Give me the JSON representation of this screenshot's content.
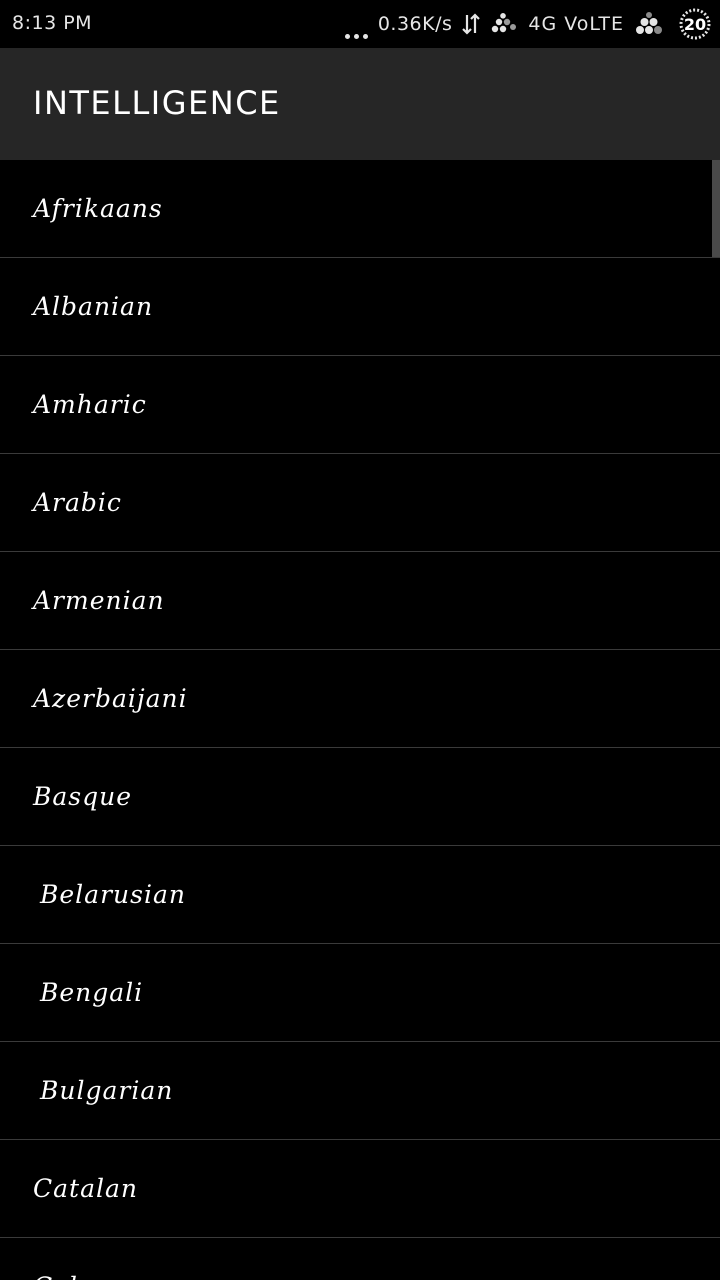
{
  "status_bar": {
    "time": "8:13 PM",
    "net_speed": "0.36K/s",
    "network": "4G VoLTE",
    "battery": "20",
    "icons": [
      "more-dots-icon",
      "data-arrows-icon",
      "signal-icon",
      "signal-icon-2",
      "battery-icon"
    ]
  },
  "app_bar": {
    "title": "INTELLIGENCE"
  },
  "languages": [
    {
      "label": "Afrikaans"
    },
    {
      "label": "Albanian"
    },
    {
      "label": "Amharic"
    },
    {
      "label": "Arabic"
    },
    {
      "label": "Armenian"
    },
    {
      "label": "Azerbaijani"
    },
    {
      "label": "Basque"
    },
    {
      "label": " Belarusian"
    },
    {
      "label": " Bengali"
    },
    {
      "label": " Bulgarian"
    },
    {
      "label": "Catalan"
    },
    {
      "label": "Cebuano"
    }
  ],
  "colors": {
    "background": "#000000",
    "app_bar": "#262626",
    "divider": "#3a3a3a",
    "text": "#ffffff"
  }
}
